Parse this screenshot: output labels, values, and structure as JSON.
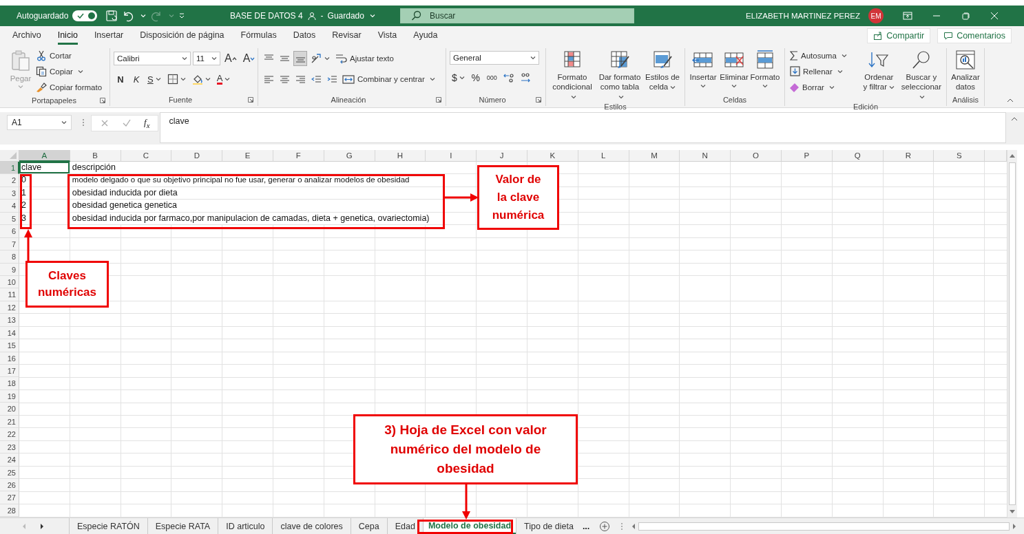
{
  "title_bar": {
    "autosave_label": "Autoguardado",
    "autosave_on": true,
    "redo_disabled": true,
    "document_title": "BASE DE DATOS 4",
    "separator": "-",
    "save_status": "Guardado",
    "search_placeholder": "Buscar",
    "user_name": "ELIZABETH MARTINEZ PEREZ",
    "user_initials": "EM"
  },
  "menu_tabs": [
    {
      "label": "Archivo",
      "selected": false
    },
    {
      "label": "Inicio",
      "selected": true
    },
    {
      "label": "Insertar",
      "selected": false
    },
    {
      "label": "Disposición de página",
      "selected": false
    },
    {
      "label": "Fórmulas",
      "selected": false
    },
    {
      "label": "Datos",
      "selected": false
    },
    {
      "label": "Revisar",
      "selected": false
    },
    {
      "label": "Vista",
      "selected": false
    },
    {
      "label": "Ayuda",
      "selected": false
    }
  ],
  "share_button": "Compartir",
  "comments_button": "Comentarios",
  "ribbon": {
    "groups": [
      {
        "label": "Portapapeles",
        "launcher": true,
        "items": [
          {
            "kind": "large",
            "label": "Pegar",
            "caret": true,
            "disabled": true
          },
          {
            "kind": "stack",
            "items": [
              {
                "label": "Cortar",
                "caret": false
              },
              {
                "label": "Copiar",
                "caret": true
              },
              {
                "label": "Copiar formato",
                "caret": false
              }
            ]
          }
        ]
      },
      {
        "label": "Fuente",
        "launcher": true,
        "items": [
          {
            "kind": "lines",
            "lines": [
              {
                "tools": [
                  {
                    "kind": "combo",
                    "value": "Calibri"
                  },
                  {
                    "kind": "combo",
                    "value": "11"
                  },
                  {
                    "kind": "tool",
                    "text": "A",
                    "caret": false
                  },
                  {
                    "kind": "tool",
                    "text": "A",
                    "caret": false
                  }
                ]
              },
              {
                "tools": [
                  {
                    "kind": "tool",
                    "text": "N",
                    "caret": false
                  },
                  {
                    "kind": "tool",
                    "text": "K",
                    "caret": false
                  },
                  {
                    "kind": "tool",
                    "text": "S",
                    "caret": true
                  },
                  {
                    "kind": "tool",
                    "caret": true
                  },
                  {
                    "kind": "tool",
                    "caret": true
                  },
                  {
                    "kind": "colortool",
                    "text": "A",
                    "caret": true
                  }
                ]
              }
            ]
          }
        ]
      },
      {
        "label": "Alineación",
        "launcher": true,
        "items": [
          {
            "kind": "lines",
            "lines": [
              {
                "tools": [
                  {
                    "kind": "tool",
                    "caret": false,
                    "selected": false
                  },
                  {
                    "kind": "tool",
                    "caret": false,
                    "selected": false
                  },
                  {
                    "kind": "tool",
                    "caret": false,
                    "selected": true
                  },
                  {
                    "kind": "tool",
                    "caret": true
                  },
                  {
                    "kind": "small",
                    "label": "Ajustar texto",
                    "caret": false
                  }
                ]
              },
              {
                "tools": [
                  {
                    "kind": "tool",
                    "caret": false
                  },
                  {
                    "kind": "tool",
                    "caret": false
                  },
                  {
                    "kind": "tool",
                    "caret": false
                  },
                  {
                    "kind": "tool",
                    "caret": false
                  },
                  {
                    "kind": "tool",
                    "caret": false
                  },
                  {
                    "kind": "small",
                    "label": "Combinar y centrar",
                    "caret": true
                  }
                ]
              }
            ]
          }
        ]
      },
      {
        "label": "Número",
        "launcher": true,
        "items": [
          {
            "kind": "lines",
            "lines": [
              {
                "tools": [
                  {
                    "kind": "combo",
                    "value": "General"
                  }
                ]
              },
              {
                "tools": [
                  {
                    "kind": "tool",
                    "text": "$",
                    "caret": true
                  },
                  {
                    "kind": "tool",
                    "text": "%",
                    "caret": false
                  },
                  {
                    "kind": "tool",
                    "text": "000",
                    "caret": false
                  },
                  {
                    "kind": "tool",
                    "caret": false
                  },
                  {
                    "kind": "tool",
                    "caret": false
                  }
                ]
              }
            ]
          }
        ]
      },
      {
        "label": "Estilos",
        "launcher": false,
        "items": [
          {
            "kind": "large",
            "label": "Formato condicional",
            "caret": true,
            "disabled": false
          },
          {
            "kind": "large",
            "label": "Dar formato como tabla",
            "caret": true,
            "disabled": false
          },
          {
            "kind": "large",
            "label": "Estilos de celda",
            "caret": true,
            "disabled": false
          }
        ]
      },
      {
        "label": "Celdas",
        "launcher": false,
        "items": [
          {
            "kind": "large",
            "label": "Insertar",
            "caret": true,
            "disabled": false
          },
          {
            "kind": "large",
            "label": "Eliminar",
            "caret": true,
            "disabled": false
          },
          {
            "kind": "large",
            "label": "Formato",
            "caret": true,
            "disabled": false
          }
        ]
      },
      {
        "label": "Edición",
        "launcher": false,
        "items": [
          {
            "kind": "stack",
            "items": [
              {
                "label": "Autosuma",
                "caret": true
              },
              {
                "label": "Rellenar",
                "caret": true
              },
              {
                "label": "Borrar",
                "caret": true
              }
            ]
          },
          {
            "kind": "large",
            "label": "Ordenar y filtrar",
            "caret": true,
            "disabled": false
          },
          {
            "kind": "large",
            "label": "Buscar y seleccionar",
            "caret": true,
            "disabled": false
          }
        ]
      },
      {
        "label": "Análisis",
        "launcher": false,
        "items": [
          {
            "kind": "large",
            "label": "Analizar datos",
            "caret": false,
            "disabled": false
          }
        ]
      }
    ]
  },
  "formula_bar": {
    "name_box": "A1",
    "function_label": "f$_{x}$",
    "formula": "clave"
  },
  "sheet": {
    "columns": [
      {
        "label": "A",
        "selected": true
      },
      {
        "label": "B",
        "selected": false
      },
      {
        "label": "C",
        "selected": false
      },
      {
        "label": "D",
        "selected": false
      },
      {
        "label": "E",
        "selected": false
      },
      {
        "label": "F",
        "selected": false
      },
      {
        "label": "G",
        "selected": false
      },
      {
        "label": "H",
        "selected": false
      },
      {
        "label": "I",
        "selected": false
      },
      {
        "label": "J",
        "selected": false
      },
      {
        "label": "K",
        "selected": false
      },
      {
        "label": "L",
        "selected": false
      },
      {
        "label": "M",
        "selected": false
      },
      {
        "label": "N",
        "selected": false
      },
      {
        "label": "O",
        "selected": false
      },
      {
        "label": "P",
        "selected": false
      },
      {
        "label": "Q",
        "selected": false
      },
      {
        "label": "R",
        "selected": false
      },
      {
        "label": "S",
        "selected": false
      }
    ],
    "rows": [
      {
        "number": "1",
        "selected": true,
        "cells": [
          {
            "text": "clave",
            "selected": true
          },
          {
            "text": "descripción",
            "selected": false
          }
        ]
      },
      {
        "number": "2",
        "selected": false,
        "cells": [
          {
            "text": "0",
            "selected": false
          },
          {
            "text": "modelo delgado o que su objetivo principal no fue usar, generar o analizar modelos de obesidad",
            "selected": false
          }
        ]
      },
      {
        "number": "3",
        "selected": false,
        "cells": [
          {
            "text": "1",
            "selected": false
          },
          {
            "text": "obesidad inducida por dieta",
            "selected": false
          }
        ]
      },
      {
        "number": "4",
        "selected": false,
        "cells": [
          {
            "text": "2",
            "selected": false
          },
          {
            "text": "obesidad genetica genetica",
            "selected": false
          }
        ]
      },
      {
        "number": "5",
        "selected": false,
        "cells": [
          {
            "text": "3",
            "selected": false
          },
          {
            "text": "obesidad inducida por farmaco,por manipulacion de camadas, dieta + genetica, ovariectomia)",
            "selected": false
          }
        ]
      },
      {
        "number": "6",
        "selected": false
      },
      {
        "number": "7",
        "selected": false
      },
      {
        "number": "8",
        "selected": false
      },
      {
        "number": "9",
        "selected": false
      },
      {
        "number": "10",
        "selected": false
      },
      {
        "number": "11",
        "selected": false
      },
      {
        "number": "12",
        "selected": false
      },
      {
        "number": "13",
        "selected": false
      },
      {
        "number": "14",
        "selected": false
      },
      {
        "number": "15",
        "selected": false
      },
      {
        "number": "16",
        "selected": false
      },
      {
        "number": "17",
        "selected": false
      },
      {
        "number": "18",
        "selected": false
      },
      {
        "number": "19",
        "selected": false
      },
      {
        "number": "20",
        "selected": false
      },
      {
        "number": "21",
        "selected": false
      },
      {
        "number": "22",
        "selected": false
      },
      {
        "number": "23",
        "selected": false
      },
      {
        "number": "24",
        "selected": false
      },
      {
        "number": "25",
        "selected": false
      },
      {
        "number": "26",
        "selected": false
      },
      {
        "number": "27",
        "selected": false
      },
      {
        "number": "28",
        "selected": false
      }
    ]
  },
  "sheet_tabs": [
    {
      "label": "Especie RATÓN",
      "selected": false
    },
    {
      "label": "Especie RATA",
      "selected": false
    },
    {
      "label": "ID articulo",
      "selected": false
    },
    {
      "label": "clave de colores",
      "selected": false
    },
    {
      "label": "Cepa",
      "selected": false
    },
    {
      "label": "Edad",
      "selected": false
    },
    {
      "label": "Modelo de obesidad",
      "selected": true
    },
    {
      "label": "Tipo de dieta",
      "selected": false
    }
  ],
  "more_tabs": "...",
  "annotations": [
    {
      "text": "Valor de la clave numérica"
    },
    {
      "text": "Claves numéricas"
    },
    {
      "text": "3) Hoja de Excel con valor numérico del modelo de obesidad"
    }
  ]
}
